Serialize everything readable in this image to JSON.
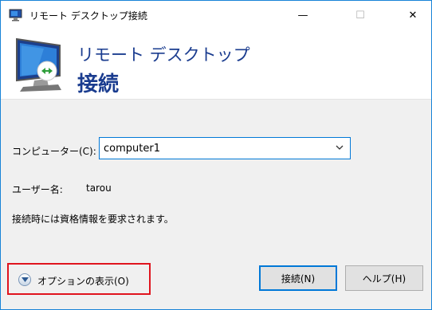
{
  "window": {
    "title": "リモート デスクトップ接続",
    "controls": {
      "minimize": "—",
      "maximize": "☐",
      "close": "✕"
    }
  },
  "banner": {
    "subtitle": "リモート デスクトップ",
    "heading": "接続"
  },
  "form": {
    "computer_label": "コンピューター(C):",
    "computer_value": "computer1",
    "user_label": "ユーザー名:",
    "user_value": "tarou",
    "credential_notice": "接続時には資格情報を要求されます。"
  },
  "footer": {
    "options_label": "オプションの表示(O)",
    "connect_label": "接続(N)",
    "help_label": "ヘルプ(H)"
  },
  "colors": {
    "accent": "#0078d7",
    "heading": "#1a3c8f",
    "highlight": "#e0141e"
  }
}
